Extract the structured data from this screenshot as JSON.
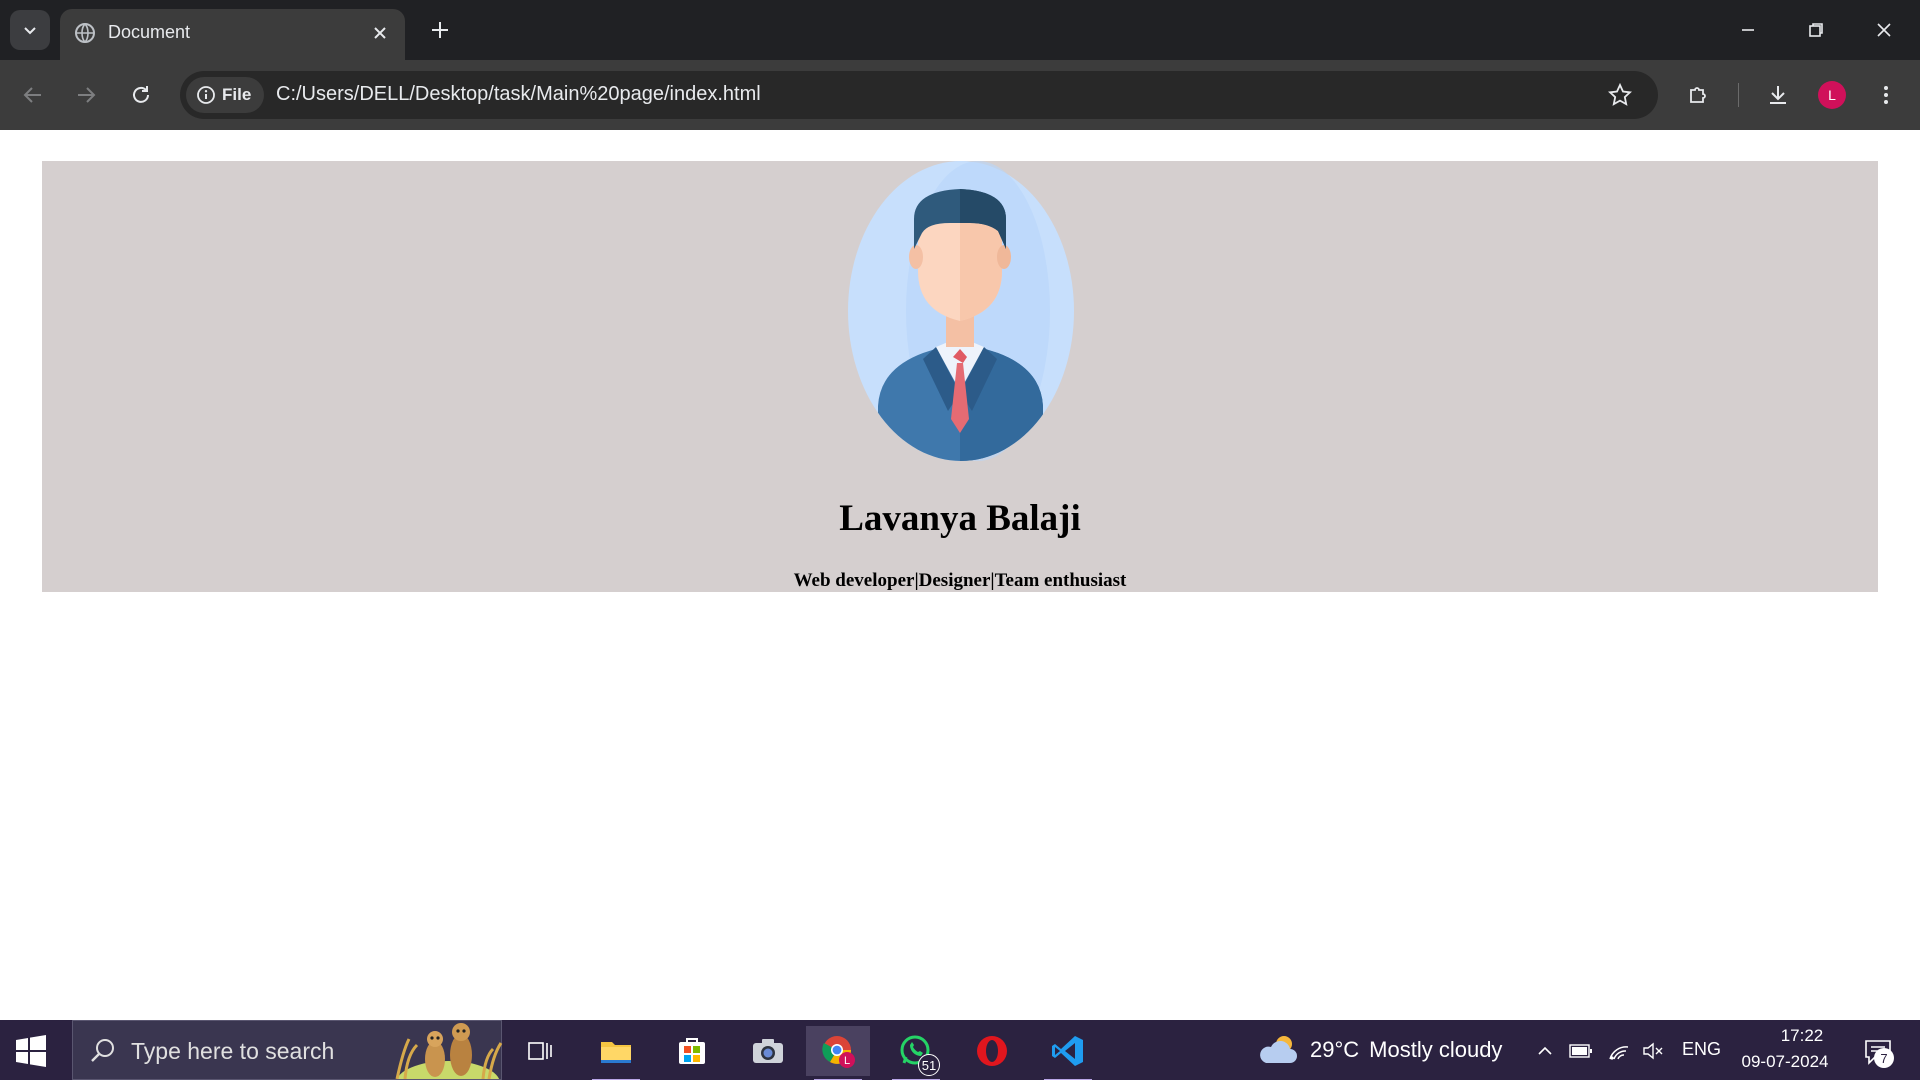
{
  "browser": {
    "tab": {
      "title": "Document",
      "favicon": "globe-icon"
    },
    "address": {
      "chip_label": "File",
      "url": "C:/Users/DELL/Desktop/task/Main%20page/index.html"
    },
    "profile_initial": "L",
    "colors": {
      "tabbar": "#202124",
      "toolbar": "#3c3c3c",
      "profile": "#d0105a"
    }
  },
  "page": {
    "name": "Lavanya Balaji",
    "tagline": "Web developer|Designer|Team enthusiast",
    "hero_background": "#d5cfcf",
    "avatar": "businessman-avatar-illustration"
  },
  "taskbar": {
    "search_placeholder": "Type here to search",
    "apps": [
      {
        "name": "task-view",
        "icon": "task-view-icon"
      },
      {
        "name": "file-explorer",
        "icon": "folder-icon"
      },
      {
        "name": "microsoft-store",
        "icon": "store-icon"
      },
      {
        "name": "camera",
        "icon": "camera-icon"
      },
      {
        "name": "chrome",
        "icon": "chrome-icon"
      },
      {
        "name": "whatsapp",
        "icon": "whatsapp-icon",
        "badge": "51"
      },
      {
        "name": "opera",
        "icon": "opera-icon"
      },
      {
        "name": "vscode",
        "icon": "vscode-icon"
      }
    ],
    "weather": {
      "temp": "29°C",
      "condition": "Mostly cloudy"
    },
    "language": "ENG",
    "time": "17:22",
    "date": "09-07-2024",
    "notification_count": "7"
  }
}
